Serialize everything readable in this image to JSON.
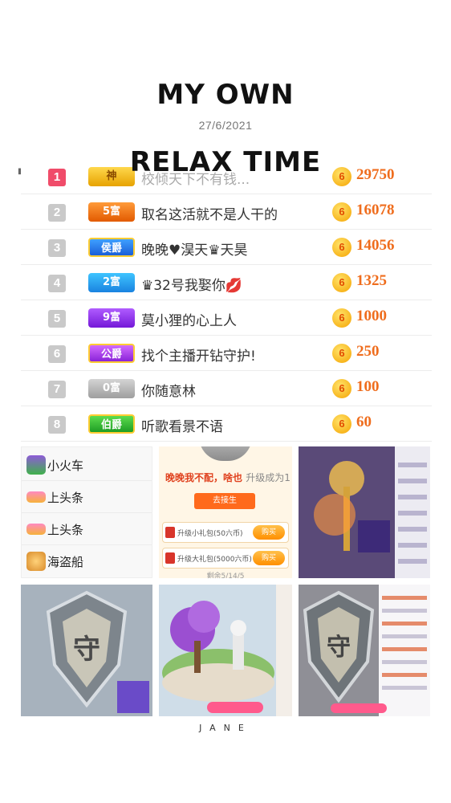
{
  "header": {
    "title": "MY OWN",
    "date": "27/6/2021",
    "subtitle": "RELAX TIME"
  },
  "leaderboard": [
    {
      "rank": "1",
      "badge": "神",
      "name": "校倾天下不有钱...",
      "score": "29750"
    },
    {
      "rank": "2",
      "badge": "5富",
      "name": "取名这活就不是人干的",
      "score": "16078"
    },
    {
      "rank": "3",
      "badge": "侯爵",
      "name": "晚晚♥淏天♛天昊",
      "score": "14056"
    },
    {
      "rank": "4",
      "badge": "2富",
      "name": "♛32号我娶你💋",
      "score": "1325"
    },
    {
      "rank": "5",
      "badge": "9富",
      "name": "莫小狸的心上人",
      "score": "1000"
    },
    {
      "rank": "6",
      "badge": "公爵",
      "name": "找个主播开钻守护!",
      "score": "250"
    },
    {
      "rank": "7",
      "badge": "0富",
      "name": "你随意林",
      "score": "100"
    },
    {
      "rank": "8",
      "badge": "伯爵",
      "name": "听歌看景不语",
      "score": "60"
    }
  ],
  "coin_symbol": "6",
  "gift_menu": [
    {
      "label": "小火车",
      "icon": "train-icon"
    },
    {
      "label": "上头条",
      "icon": "headline-icon"
    },
    {
      "label": "上头条",
      "icon": "headline-icon"
    },
    {
      "label": "海盗船",
      "icon": "pirate-ship-icon"
    }
  ],
  "guard_panel": {
    "headline": "晚晚我不配，啥也",
    "upgrade_text": "升级成为1",
    "guard_button": "去接生",
    "upgrades": [
      {
        "label": "升级小礼包(50六币)",
        "button": "购买"
      },
      {
        "label": "升级大礼包(5000六币)",
        "button": "购买"
      }
    ],
    "footer": "剩余5/14/5"
  },
  "footer": {
    "signature": "JANE"
  },
  "colors": {
    "score": "#ef6d1d",
    "rank_first": "#f04c6a",
    "coin": "#f5a300"
  }
}
